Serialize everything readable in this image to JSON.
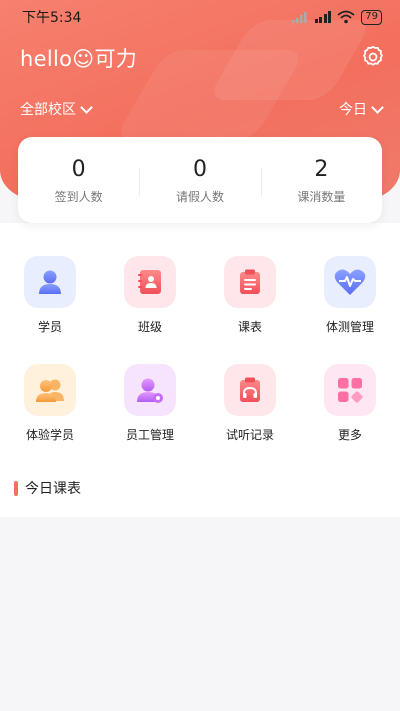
{
  "status_bar": {
    "time": "下午5:34",
    "battery": "79"
  },
  "header": {
    "greeting": "hello☺可力",
    "campus": "全部校区",
    "date": "今日"
  },
  "stats": [
    {
      "value": "0",
      "label": "签到人数"
    },
    {
      "value": "0",
      "label": "请假人数"
    },
    {
      "value": "2",
      "label": "课消数量"
    }
  ],
  "menu": [
    {
      "label": "学员",
      "icon": "student-icon"
    },
    {
      "label": "班级",
      "icon": "class-icon"
    },
    {
      "label": "课表",
      "icon": "schedule-icon"
    },
    {
      "label": "体测管理",
      "icon": "physical-test-icon"
    },
    {
      "label": "体验学员",
      "icon": "trial-student-icon"
    },
    {
      "label": "员工管理",
      "icon": "staff-icon"
    },
    {
      "label": "试听记录",
      "icon": "audition-icon"
    },
    {
      "label": "更多",
      "icon": "more-icon"
    }
  ],
  "today_section": {
    "title": "今日课表"
  },
  "colors": {
    "brand": "#f36f5e",
    "page_bg": "#f6f6f8"
  }
}
